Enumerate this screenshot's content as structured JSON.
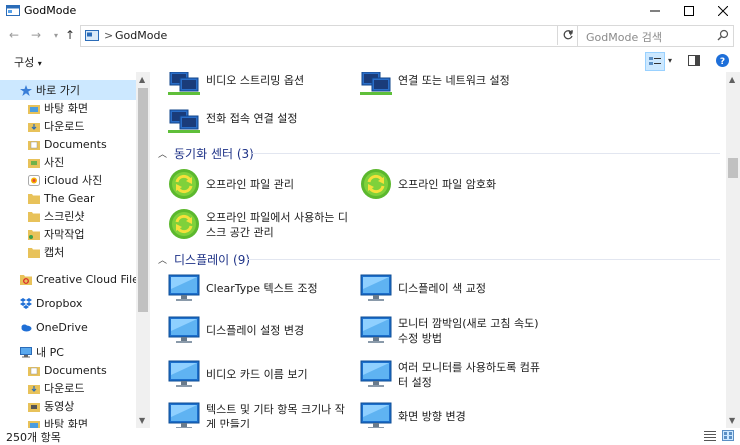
{
  "window": {
    "title": "GodMode",
    "accent": "#0078d7"
  },
  "address": {
    "crumb": "GodMode",
    "separator": ">",
    "search_placeholder": "GodMode 검색"
  },
  "command_bar": {
    "organize_label": "구성",
    "organize_chevron": "▾"
  },
  "sidebar": {
    "items": [
      {
        "label": "바로 가기",
        "icon": "star-icon",
        "pinned": false,
        "selected": true
      },
      {
        "label": "바탕 화면",
        "icon": "folder-icon",
        "pinned": true
      },
      {
        "label": "다운로드",
        "icon": "folder-icon",
        "pinned": true
      },
      {
        "label": "Documents",
        "icon": "folder-icon",
        "pinned": true
      },
      {
        "label": "사진",
        "icon": "folder-icon",
        "pinned": true
      },
      {
        "label": "iCloud 사진",
        "icon": "icloud-icon",
        "pinned": true
      },
      {
        "label": "The Gear",
        "icon": "folder-icon",
        "pinned": false
      },
      {
        "label": "스크린샷",
        "icon": "folder-icon",
        "pinned": false
      },
      {
        "label": "자막작업",
        "icon": "folder-icon",
        "pinned": false
      },
      {
        "label": "캡처",
        "icon": "folder-icon",
        "pinned": false
      },
      {
        "label": "Creative Cloud Files",
        "icon": "creative-cloud-icon",
        "pinned": false
      },
      {
        "label": "Dropbox",
        "icon": "dropbox-icon",
        "pinned": false
      },
      {
        "label": "OneDrive",
        "icon": "onedrive-icon",
        "pinned": false
      },
      {
        "label": "내 PC",
        "icon": "pc-icon",
        "pinned": false
      },
      {
        "label": "Documents",
        "icon": "folder-icon",
        "pinned": false
      },
      {
        "label": "다운로드",
        "icon": "folder-icon",
        "pinned": false
      },
      {
        "label": "동영상",
        "icon": "folder-icon",
        "pinned": false
      },
      {
        "label": "바탕 화면",
        "icon": "folder-icon",
        "pinned": false
      }
    ]
  },
  "content": {
    "top_items": [
      {
        "label": "비디오 스트리밍 옵션",
        "icon": "network-icon"
      },
      {
        "label": "연결 또는 네트워크 설정",
        "icon": "network-icon"
      },
      {
        "label": "전화 접속 연결 설정",
        "icon": "network-icon"
      }
    ],
    "groups": [
      {
        "title": "동기화 센터 (3)",
        "items": [
          {
            "label": "오프라인 파일 관리",
            "icon": "sync-icon"
          },
          {
            "label": "오프라인 파일 암호화",
            "icon": "sync-icon"
          },
          {
            "label": "오프라인 파일에서 사용하는 디스크 공간 관리",
            "icon": "sync-icon"
          }
        ]
      },
      {
        "title": "디스플레이 (9)",
        "items": [
          {
            "label": "ClearType 텍스트 조정",
            "icon": "monitor-icon"
          },
          {
            "label": "디스플레이 색 교정",
            "icon": "monitor-icon"
          },
          {
            "label": "디스플레이 설정 변경",
            "icon": "monitor-icon"
          },
          {
            "label": "모니터 깜박임(새로 고침 속도) 수정 방법",
            "icon": "monitor-icon"
          },
          {
            "label": "비디오 카드 이름 보기",
            "icon": "monitor-icon"
          },
          {
            "label": "여러 모니터를 사용하도록 컴퓨터 설정",
            "icon": "monitor-icon"
          },
          {
            "label": "텍스트 및 기타 항목 크기나 작게 만들기",
            "icon": "monitor-icon"
          },
          {
            "label": "화면 방향 변경",
            "icon": "monitor-icon"
          }
        ]
      }
    ]
  },
  "status": {
    "count": "250개 항목"
  }
}
